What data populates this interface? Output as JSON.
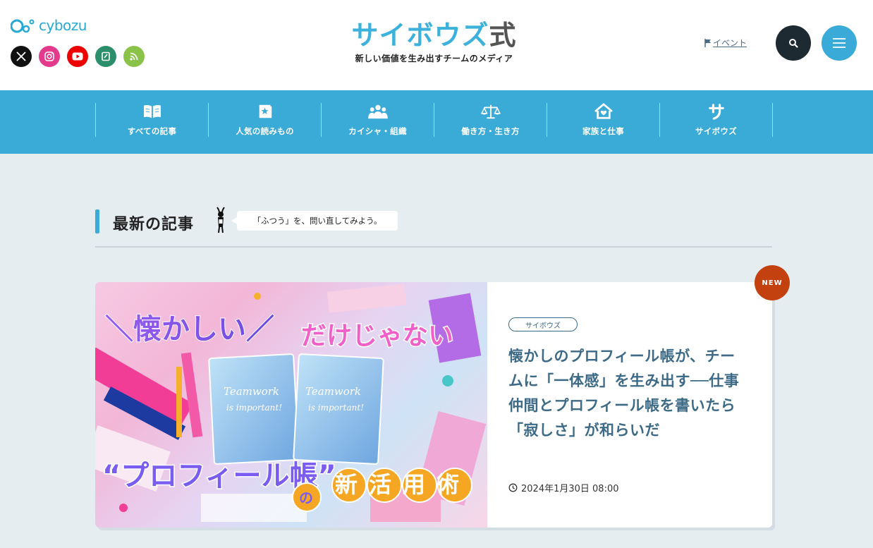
{
  "header": {
    "logo_text": "cybozu",
    "brand_main": "サイボウズ",
    "brand_suffix": "式",
    "tagline": "新しい価値を生み出すチームのメディア",
    "event_label": "イベント",
    "socials": [
      {
        "name": "x",
        "icon": "x-icon",
        "color": "#111111"
      },
      {
        "name": "instagram",
        "icon": "instagram-icon",
        "color": "#e33a8b"
      },
      {
        "name": "youtube",
        "icon": "youtube-icon",
        "color": "#ee0000"
      },
      {
        "name": "note",
        "icon": "note-icon",
        "color": "#2c8f6b"
      },
      {
        "name": "rss",
        "icon": "rss-icon",
        "color": "#8bc34a"
      }
    ]
  },
  "nav": {
    "items": [
      {
        "label": "すべての記事",
        "icon": "book-icon"
      },
      {
        "label": "人気の読みもの",
        "icon": "ranking-book-icon"
      },
      {
        "label": "カイシャ・組織",
        "icon": "people-group-icon"
      },
      {
        "label": "働き方・生き方",
        "icon": "scale-icon"
      },
      {
        "label": "家族と仕事",
        "icon": "house-icon"
      },
      {
        "label": "サイボウズ",
        "icon": "sa-icon"
      }
    ]
  },
  "latest": {
    "title": "最新の記事",
    "bubble": "「ふつう」を、問い直してみよう。"
  },
  "article": {
    "badge": "NEW",
    "tag": "サイボウズ",
    "title": "懐かしのプロフィール帳が、チームに「一体感」を生み出す──仕事仲間とプロフィール帳を書いたら「寂しさ」が和らいだ",
    "date": "2024年1月30日 08:00",
    "thumbnail": {
      "line1": "＼懐かしい／",
      "line2": "だけじゃない",
      "book_text_1": "Teamwork",
      "book_text_2": "is important!",
      "line3": "“プロフィール帳”",
      "line4_small": "の",
      "line4": "新活用術"
    }
  },
  "colors": {
    "accent": "#3aaad6",
    "article_title": "#3d6a86",
    "new_badge": "#c2410f",
    "background": "#e5edf1"
  }
}
